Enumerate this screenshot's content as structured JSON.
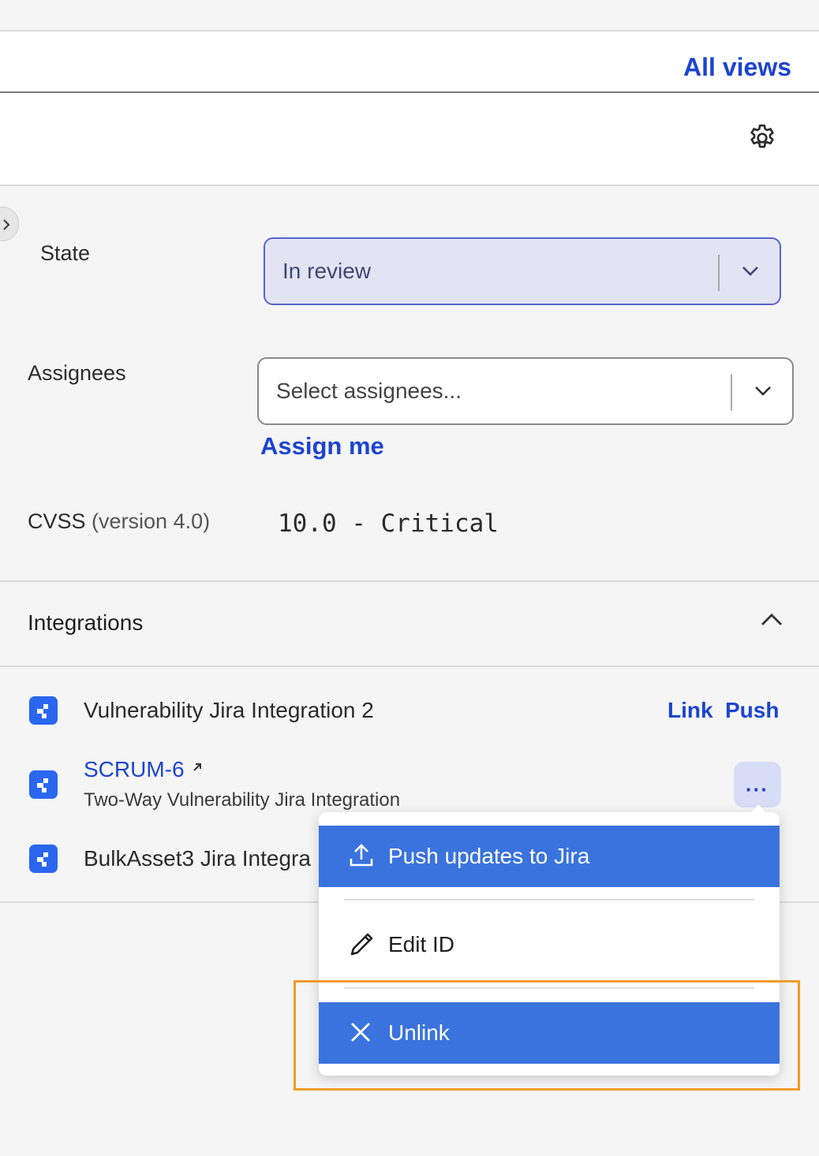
{
  "header": {
    "all_views_label": "All views"
  },
  "fields": {
    "state": {
      "label": "State",
      "value": "In review"
    },
    "assignees": {
      "label": "Assignees",
      "placeholder": "Select assignees...",
      "assign_me": "Assign me"
    },
    "cvss": {
      "label": "CVSS",
      "version": "(version 4.0)",
      "value": "10.0 - Critical"
    }
  },
  "integrations": {
    "title": "Integrations",
    "items": [
      {
        "name": "Vulnerability Jira Integration 2",
        "link_label": "Link",
        "push_label": "Push"
      },
      {
        "ticket": "SCRUM-6",
        "name": "Two-Way Vulnerability Jira Integration",
        "more_label": "···"
      },
      {
        "name": "BulkAsset3 Jira Integra"
      }
    ]
  },
  "menu": {
    "items": [
      {
        "label": "Push updates to Jira",
        "icon": "upload-icon"
      },
      {
        "label": "Edit ID",
        "icon": "pencil-icon"
      },
      {
        "label": "Unlink",
        "icon": "close-icon"
      }
    ]
  },
  "colors": {
    "link_blue": "#1d44d1",
    "menu_active": "#3a73dd",
    "highlight": "#f09a2a",
    "jira_blue": "#2a66f0"
  }
}
